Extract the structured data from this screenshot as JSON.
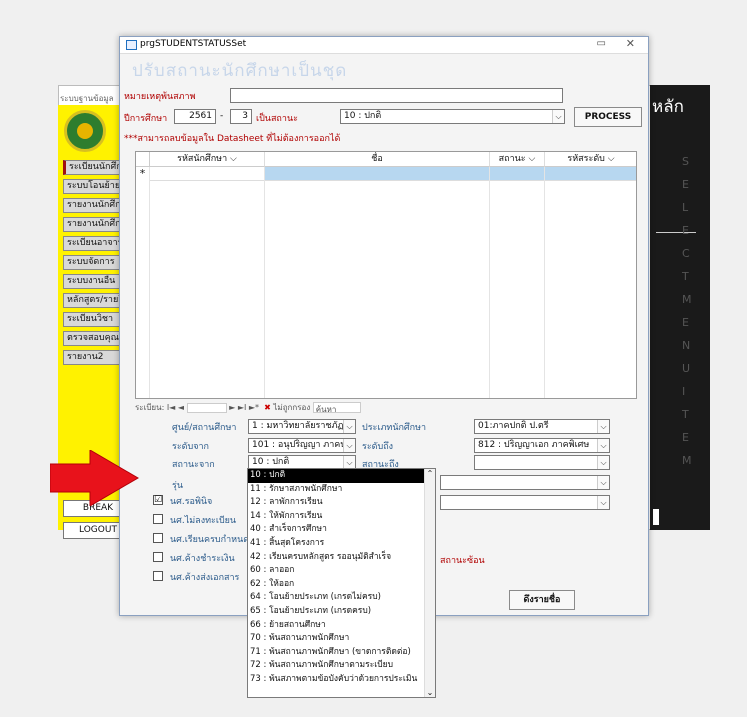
{
  "background": {
    "app_title": "ระบบฐานข้อมูล",
    "right_title": "หลัก",
    "right_letters": [
      "S",
      "E",
      "L",
      "E",
      "C",
      "T",
      "M",
      "E",
      "N",
      "U",
      "I",
      "T",
      "E",
      "M"
    ],
    "menu": [
      "ระเบียนนักศึกษา",
      "ระบบโอนย้าย",
      "รายงานนักศึกษา",
      "รายงานนักศึกษา",
      "ระเบียนอาจารย์",
      "ระบบจัดการ",
      "ระบบงานอื่น",
      "หลักสูตร/รายวิชา",
      "ระเบียนวิชา",
      "ตรวจสอบคุณสมบัติ",
      "รายงาน2"
    ],
    "buttons": {
      "break": "BREAK",
      "logout": "LOGOUT"
    }
  },
  "dialog": {
    "window_title": "prgSTUDENTSTATUSSet",
    "heading": "ปรับสถานะนักศึกษาเป็นชุด",
    "note_label": "หมายเหตุพ้นสภาพ",
    "note_value": "",
    "year_label": "ปีการศึกษา",
    "year_value": "2561",
    "term_sep": "-",
    "term_value": "3",
    "status_label": "เป็นสถานะ",
    "status_value": "10 : ปกติ",
    "process_label": "PROCESS",
    "hint": "***สามารถลบข้อมูลใน Datasheet ที่ไม่ต้องการออกได้",
    "grid": {
      "columns": [
        "รหัสนักศึกษา",
        "ชื่อ",
        "สถานะ",
        "รหัสระดับ"
      ],
      "new_row_marker": "*"
    },
    "nav": {
      "record_label": "ระเบียน:",
      "first": "I◄",
      "prev": "◄",
      "next": "►",
      "last": "►I",
      "new": "►*",
      "filter_label": "ไม่ถูกกรอง",
      "search_label": "ค้นหา"
    },
    "filters": {
      "center_label": "ศูนย์/สถานศึกษา",
      "center_value": "1 : มหาวิทยาลัยราชภัฏเชียงใหม่",
      "type_label": "ประเภทนักศึกษา",
      "type_value": "01:ภาคปกติ ป.ตรี",
      "level_from_label": "ระดับจาก",
      "level_from_value": "101 : อนุปริญญา ภาคปกติ",
      "level_to_label": "ระดับถึง",
      "level_to_value": "812 : ปริญญาเอก ภาคพิเศษ",
      "status_from_label": "สถานะจาก",
      "status_from_value": "10 : ปกติ",
      "status_to_label": "สถานะถึง",
      "status_to_value": "",
      "batch_label": "รุ่น",
      "row5_value": "",
      "row6_value": ""
    },
    "checkboxes": [
      {
        "label": "นศ.รอพินิจ",
        "checked": true,
        "mark": "☑"
      },
      {
        "label": "นศ.ไม่ลงทะเบียน",
        "checked": false,
        "mark": ""
      },
      {
        "label": "นศ.เรียนครบกำหนด",
        "checked": false,
        "mark": ""
      },
      {
        "label": "นศ.ค้างชำระเงิน",
        "checked": false,
        "mark": ""
      },
      {
        "label": "นศ.ค้างส่งเอกสาร",
        "checked": false,
        "mark": ""
      }
    ],
    "status_overlap_note": "สถานะซ้อน",
    "list_names_label": "ดึงรายชื่อ",
    "status_options": [
      "10 : ปกติ",
      "11 : รักษาสภาพนักศึกษา",
      "12 : ลาพักการเรียน",
      "14 : ให้พักการเรียน",
      "40 : สำเร็จการศึกษา",
      "41 : สิ้นสุดโครงการ",
      "42 : เรียนครบหลักสูตร รออนุมัติสำเร็จ",
      "60 : ลาออก",
      "62 : ให้ออก",
      "64 : โอนย้ายประเภท (เกรดไม่ครบ)",
      "65 : โอนย้ายประเภท (เกรดครบ)",
      "66 : ย้ายสถานศึกษา",
      "70 : พ้นสถานภาพนักศึกษา",
      "71 : พ้นสถานภาพนักศึกษา (ขาดการติดต่อ)",
      "72 : พ้นสถานภาพนักศึกษาตามระเบียบ",
      "73 : พ้นสภาพตามข้อบังคับว่าด้วยการประเมิน"
    ]
  },
  "colors": {
    "arrow": "#e8121b",
    "heading": "#c7d6ea",
    "hint": "#b00000"
  }
}
